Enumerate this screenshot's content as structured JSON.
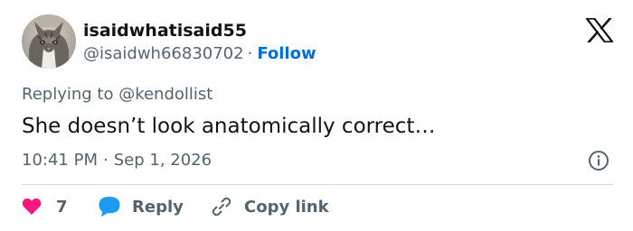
{
  "author": {
    "display_name": "isaidwhatisaid55",
    "handle": "@isaidwh66830702",
    "separator": "·",
    "follow_label": "Follow",
    "avatar": "gray-tabby-cat-photo"
  },
  "platform_icon": "x-logo-icon",
  "tweet": {
    "replying_to": "Replying to @kendollist",
    "text": "She doesn’t look anatomically correct…",
    "time": "10:41 PM",
    "separator": "·",
    "date": "Sep 1, 2026"
  },
  "actions": {
    "like_count": "7",
    "reply_label": "Reply",
    "copy_label": "Copy link"
  },
  "colors": {
    "like": "#f91880",
    "reply": "#1d9bf0",
    "follow": "#006fd6",
    "secondary_text": "#536471",
    "primary_text": "#0f1419",
    "divider": "#cfd9de"
  }
}
